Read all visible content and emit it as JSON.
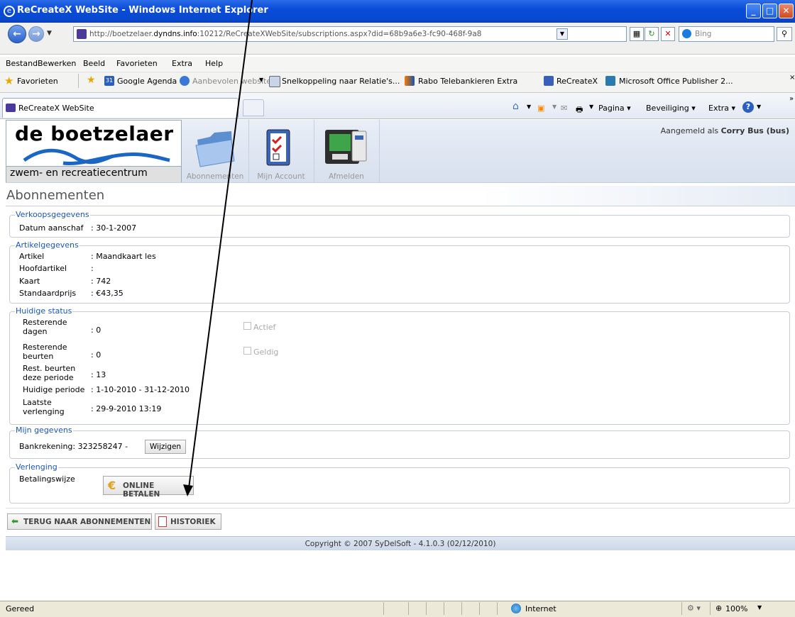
{
  "window": {
    "title": "ReCreateX WebSite - Windows Internet Explorer"
  },
  "address": {
    "url_prefix": "http://boetzelaer.",
    "url_domain": "dyndns.info",
    "url_rest": ":10212/ReCreateXWebSite/subscriptions.aspx?did=68b9a6e3-fc90-468f-9a8",
    "search_placeholder": "Bing"
  },
  "menu": [
    "Bestand",
    "Bewerken",
    "Beeld",
    "Favorieten",
    "Extra",
    "Help"
  ],
  "favorites": {
    "label": "Favorieten",
    "items": [
      "Google Agenda",
      "Aanbevolen websites",
      "Snelkoppeling naar Relatie's...",
      "Rabo Telebankieren Extra",
      "ReCreateX",
      "Microsoft Office Publisher 2..."
    ]
  },
  "tab": {
    "label": "ReCreateX WebSite"
  },
  "commands": {
    "pagina": "Pagina",
    "beveiliging": "Beveiliging",
    "extra": "Extra"
  },
  "site": {
    "logo_title": "de boetzelaer",
    "logo_subtitle": "zwem- en recreatiecentrum",
    "nav": [
      "Abonnementen",
      "Mijn Account",
      "Afmelden"
    ],
    "logged_in_prefix": "Aangemeld als ",
    "logged_in_user": "Corry Bus (bus)"
  },
  "page_title": "Abonnementen",
  "verkoop": {
    "legend": "Verkoopsgegevens",
    "datum_label": "Datum aanschaf",
    "datum_value": ": 30-1-2007"
  },
  "artikel": {
    "legend": "Artikelgegevens",
    "rows": [
      {
        "label": "Artikel",
        "value": ": Maandkaart les"
      },
      {
        "label": "Hoofdartikel",
        "value": ":"
      },
      {
        "label": "Kaart",
        "value": ": 742"
      },
      {
        "label": "Standaardprijs",
        "value": ": €43,35"
      }
    ]
  },
  "status": {
    "legend": "Huidige status",
    "rows": [
      {
        "label1": "Resterende",
        "label2": "dagen",
        "value": ": 0"
      },
      {
        "label1": "Resterende",
        "label2": "beurten",
        "value": ": 0"
      },
      {
        "label1": "Rest. beurten",
        "label2": "deze periode",
        "value": ": 13"
      },
      {
        "label1": "Huidige periode",
        "label2": "",
        "value": ": 1-10-2010 - 31-12-2010"
      },
      {
        "label1": "Laatste",
        "label2": "verlenging",
        "value": ": 29-9-2010 13:19"
      }
    ],
    "actief": "Actief",
    "geldig": "Geldig"
  },
  "mijn": {
    "legend": "Mijn gegevens",
    "bank": "Bankrekening: 323258247 -",
    "wijzigen": "Wijzigen"
  },
  "verlenging": {
    "legend": "Verlenging",
    "label": "Betalingswijze",
    "button": "ONLINE BETALEN"
  },
  "actions": {
    "back": "TERUG NAAR ABONNEMENTEN",
    "historiek": "HISTORIEK"
  },
  "copyright": "Copyright © 2007 SyDelSoft - 4.1.0.3 (02/12/2010)",
  "statusbar": {
    "text": "Gereed",
    "zone": "Internet",
    "zoom": "100%"
  }
}
